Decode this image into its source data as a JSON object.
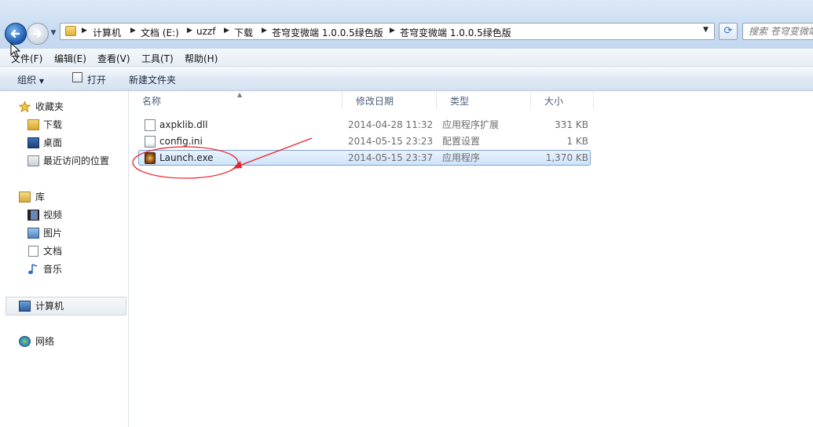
{
  "address": {
    "crumbs": [
      "计算机",
      "文档 (E:)",
      "uzzf",
      "下载",
      "苍穹变微端 1.0.0.5绿色版",
      "苍穹变微端 1.0.0.5绿色版"
    ],
    "search_placeholder": "搜索 苍穹变微端"
  },
  "menu": {
    "items": [
      "文件(F)",
      "编辑(E)",
      "查看(V)",
      "工具(T)",
      "帮助(H)"
    ]
  },
  "toolbar": {
    "organize": "组织",
    "open": "打开",
    "new_folder": "新建文件夹"
  },
  "nav": {
    "favorites": {
      "label": "收藏夹",
      "items": [
        "下载",
        "桌面",
        "最近访问的位置"
      ]
    },
    "libraries": {
      "label": "库",
      "items": [
        "视频",
        "图片",
        "文档",
        "音乐"
      ]
    },
    "computer": "计算机",
    "network": "网络"
  },
  "columns": {
    "name": "名称",
    "date": "修改日期",
    "type": "类型",
    "size": "大小"
  },
  "files": [
    {
      "name": "axpklib.dll",
      "date": "2014-04-28 11:32",
      "type": "应用程序扩展",
      "size": "331 KB",
      "icon": "dll-file-icon"
    },
    {
      "name": "config.ini",
      "date": "2014-05-15 23:23",
      "type": "配置设置",
      "size": "1 KB",
      "icon": "ini-file-icon"
    },
    {
      "name": "Launch.exe",
      "date": "2014-05-15 23:37",
      "type": "应用程序",
      "size": "1,370 KB",
      "icon": "exe-app-icon",
      "selected": true
    }
  ],
  "colors": {
    "annotation": "#e8202a",
    "selection": "#cde3fb"
  }
}
